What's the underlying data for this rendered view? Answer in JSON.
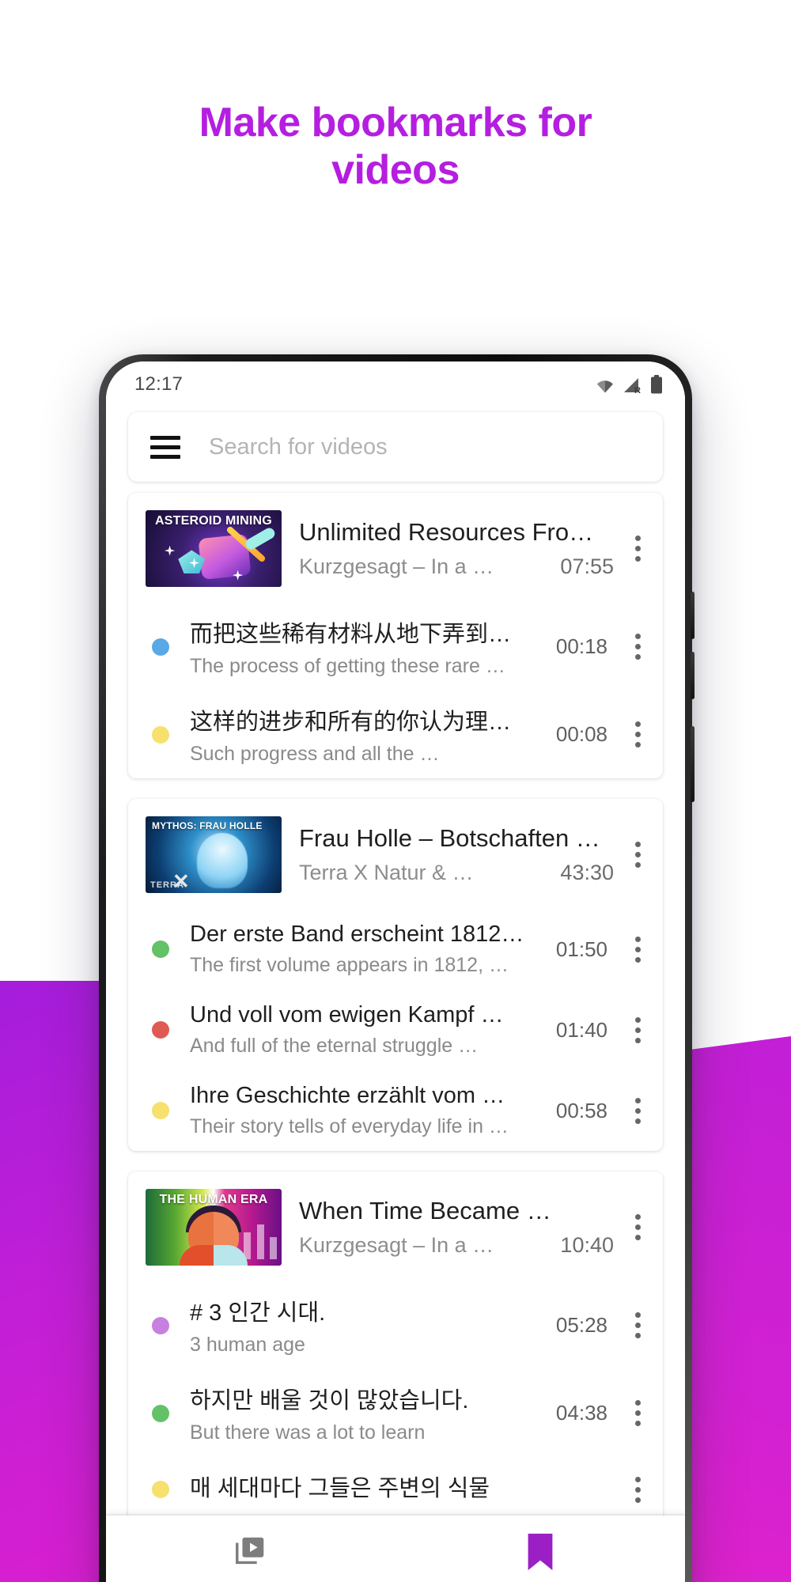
{
  "promo": {
    "headline_line1": "Make bookmarks for",
    "headline_line2": "videos",
    "accent_color": "#b51ee0"
  },
  "status_bar": {
    "time": "12:17",
    "icons": [
      "wifi-icon",
      "signal-roaming-icon",
      "battery-icon"
    ],
    "roaming_label": "R"
  },
  "search": {
    "placeholder": "Search for videos",
    "menu_icon": "hamburger-menu-icon"
  },
  "cards": [
    {
      "video": {
        "thumb_label": "ASTEROID MINING",
        "thumb_style": "th-asteroid",
        "title": "Unlimited Resources Fro…",
        "channel": "Kurzgesagt – In a …",
        "duration": "07:55"
      },
      "bookmarks": [
        {
          "dot_color": "#5aa9e6",
          "title": "而把这些稀有材料从地下弄到…",
          "subtitle": "The process of getting these rare …",
          "time": "00:18"
        },
        {
          "dot_color": "#f7e06e",
          "title": "这样的进步和所有的你认为理…",
          "subtitle": "Such progress and all the …",
          "time": "00:08"
        }
      ]
    },
    {
      "video": {
        "thumb_label": "MYTHOS: FRAU HOLLE",
        "thumb_style": "th-frauholle",
        "title": "Frau Holle – Botschaften …",
        "channel": "Terra X Natur & …",
        "duration": "43:30"
      },
      "bookmarks": [
        {
          "dot_color": "#63c167",
          "title": "Der erste Band erscheint 1812…",
          "subtitle": "The first volume appears in 1812, …",
          "time": "01:50"
        },
        {
          "dot_color": "#e05a54",
          "title": "Und voll vom ewigen Kampf …",
          "subtitle": "And full of the eternal struggle …",
          "time": "01:40"
        },
        {
          "dot_color": "#f7e06e",
          "title": "Ihre Geschichte erzählt vom …",
          "subtitle": "Their story tells of everyday life in …",
          "time": "00:58"
        }
      ]
    },
    {
      "video": {
        "thumb_label": "THE HUMAN ERA",
        "thumb_style": "th-humanera",
        "title": "When Time Became …",
        "channel": "Kurzgesagt – In a …",
        "duration": "10:40"
      },
      "bookmarks": [
        {
          "dot_color": "#c780df",
          "title": "# 3 인간 시대.",
          "subtitle": "3 human age",
          "time": "05:28"
        },
        {
          "dot_color": "#63c167",
          "title": "하지만 배울 것이 많았습니다.",
          "subtitle": "But there was a lot to learn",
          "time": "04:38"
        },
        {
          "dot_color": "#f7e06e",
          "title": "매 세대마다 그들은 주변의 식물",
          "subtitle": "",
          "time": ""
        }
      ]
    }
  ],
  "bottom_nav": {
    "items": [
      {
        "icon": "video-library-icon",
        "active": false,
        "color": "#7d7d7d"
      },
      {
        "icon": "bookmark-icon",
        "active": true,
        "color": "#9b1fc4"
      }
    ]
  }
}
